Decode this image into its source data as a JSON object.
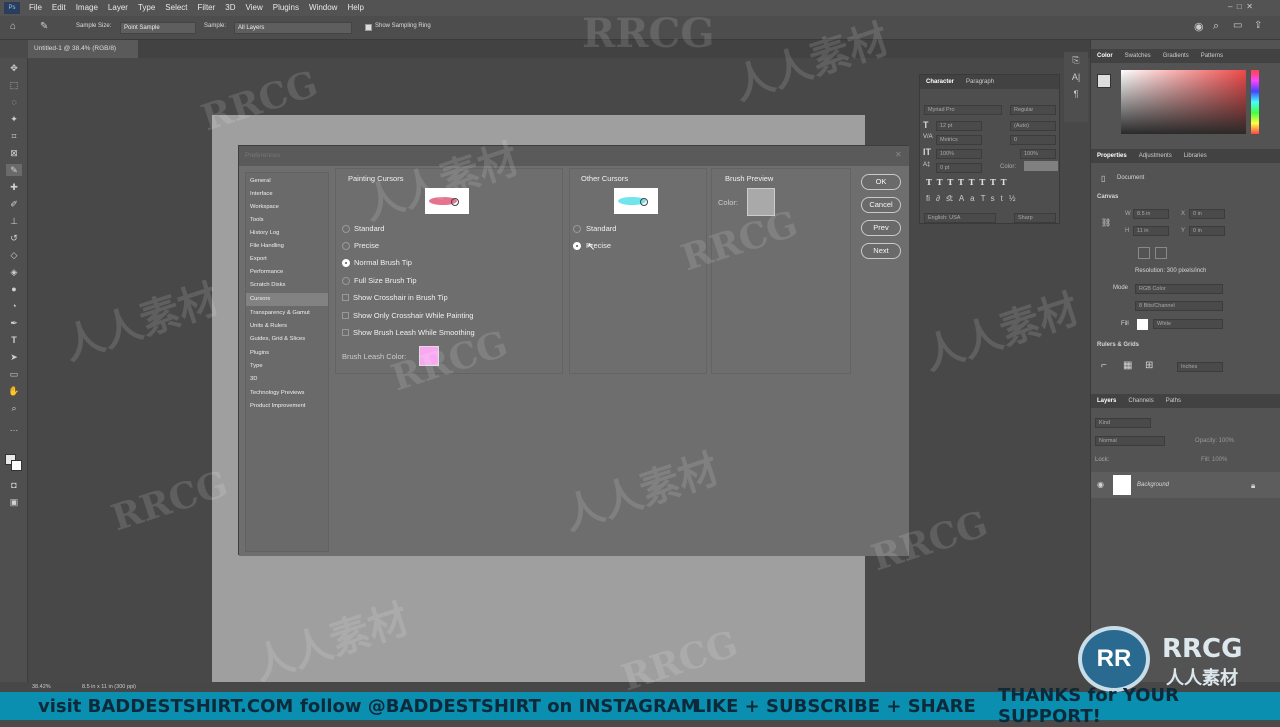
{
  "menubar": {
    "ps_label": "Ps",
    "items": [
      "File",
      "Edit",
      "Image",
      "Layer",
      "Type",
      "Select",
      "Filter",
      "3D",
      "View",
      "Plugins",
      "Window",
      "Help"
    ]
  },
  "options": {
    "sample_size_label": "Sample Size:",
    "sample_size_value": "Point Sample",
    "sample_label": "Sample:",
    "sample_value": "All Layers",
    "sampling_ring_label": "Show Sampling Ring"
  },
  "document_tab": "Untitled-1 @ 38.4% (RGB/8)",
  "dialog": {
    "title": "Preferences",
    "nav_items": [
      "General",
      "Interface",
      "Workspace",
      "Tools",
      "History Log",
      "File Handling",
      "Export",
      "Performance",
      "Scratch Disks",
      "Cursors",
      "Transparency & Gamut",
      "Units & Rulers",
      "Guides, Grid & Slices",
      "Plugins",
      "Type",
      "3D",
      "Technology Previews",
      "Product Improvement"
    ],
    "selected_nav": "Cursors",
    "painting": {
      "title": "Painting Cursors",
      "options": [
        "Standard",
        "Precise",
        "Normal Brush Tip",
        "Full Size Brush Tip"
      ],
      "checks": [
        "Show Crosshair in Brush Tip",
        "Show Only Crosshair While Painting",
        "Show Brush Leash While Smoothing"
      ],
      "leash_label": "Brush Leash Color:",
      "leash_color": "#f7a8f0"
    },
    "other": {
      "title": "Other Cursors",
      "options": [
        "Standard",
        "Precise"
      ]
    },
    "brush_preview": {
      "title": "Brush Preview",
      "color_label": "Color:",
      "color": "#a9a9a9"
    },
    "buttons": {
      "ok": "OK",
      "cancel": "Cancel",
      "prev": "Prev",
      "next": "Next"
    }
  },
  "character_panel": {
    "tabs": [
      "Character",
      "Paragraph"
    ],
    "font": "Myriad Pro",
    "style": "Regular",
    "size": "12 pt",
    "leading": "(Auto)",
    "kerning": "Metrics",
    "tracking": "0",
    "vscale": "100%",
    "hscale": "100%",
    "baseline": "0 pt",
    "color_label": "Color:",
    "language": "English: USA",
    "antialias": "Sharp"
  },
  "right": {
    "color_tabs": [
      "Color",
      "Swatches",
      "Gradients",
      "Patterns"
    ],
    "props_tabs": [
      "Properties",
      "Adjustments",
      "Libraries"
    ],
    "props_doc": "Document",
    "canvas_title": "Canvas",
    "w": "8.5 in",
    "h": "11 in",
    "x": "0 in",
    "y": "0 in",
    "resolution": "Resolution: 300 pixels/inch",
    "mode_label": "Mode",
    "mode": "RGB Color",
    "bits": "8 Bits/Channel",
    "fill_label": "Fill",
    "fill": "White",
    "rulers_title": "Rulers & Grids",
    "units": "Inches",
    "layers_tabs": [
      "Layers",
      "Channels",
      "Paths"
    ],
    "kind": "Kind",
    "blend": "Normal",
    "opacity": "Opacity: 100%",
    "lock_label": "Lock:",
    "fill_pct": "Fill: 100%",
    "layer_name": "Background"
  },
  "status": {
    "zoom": "38.42%",
    "doc_size": "8.5 in x 11 in (300 ppi)"
  },
  "banner": {
    "left": "visit BADDESTSHIRT.COM",
    "mid": "follow @BADDESTSHIRT on INSTAGRAM",
    "right1": "LIKE + SUBSCRIBE + SHARE",
    "right2": "THANKS for YOUR SUPPORT!"
  },
  "watermark": {
    "latin": "RRCG",
    "cjk": "人人素材"
  },
  "colors": {
    "accent": "#0a8fb0",
    "leash": "#f7a8f0"
  }
}
